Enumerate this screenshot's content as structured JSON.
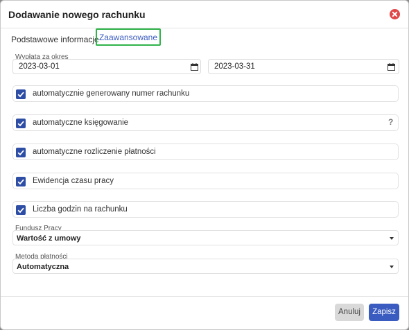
{
  "dialog": {
    "title": "Dodawanie nowego rachunku",
    "close_icon": "close-circle-icon"
  },
  "tabs": [
    {
      "label": "Podstawowe informacje",
      "active": false
    },
    {
      "label": "Zaawansowane",
      "active": true
    }
  ],
  "payout_period": {
    "label": "Wypłata za okres",
    "date_from": "2023-03-01",
    "date_to": "2023-03-31",
    "icon": "calendar-icon"
  },
  "options": [
    {
      "label": "automatycznie generowany numer rachunku",
      "checked": true
    },
    {
      "label": "automatyczne księgowanie",
      "checked": true,
      "help": "?"
    },
    {
      "label": "automatyczne rozliczenie płatności",
      "checked": true
    },
    {
      "label": "Ewidencja czasu pracy",
      "checked": true
    },
    {
      "label": "Liczba godzin na rachunku",
      "checked": true
    }
  ],
  "labor_fund": {
    "label": "Fundusz Pracy",
    "value": "Wartość z umowy"
  },
  "payment_method": {
    "label": "Metoda płatności",
    "value": "Automatyczna"
  },
  "footer": {
    "cancel_label": "Anuluj",
    "save_label": "Zapisz"
  },
  "colors": {
    "accent": "#3a5bbf",
    "checkbox": "#2e4ea6",
    "close": "#e04848",
    "tab_outline": "#2fb34a"
  }
}
